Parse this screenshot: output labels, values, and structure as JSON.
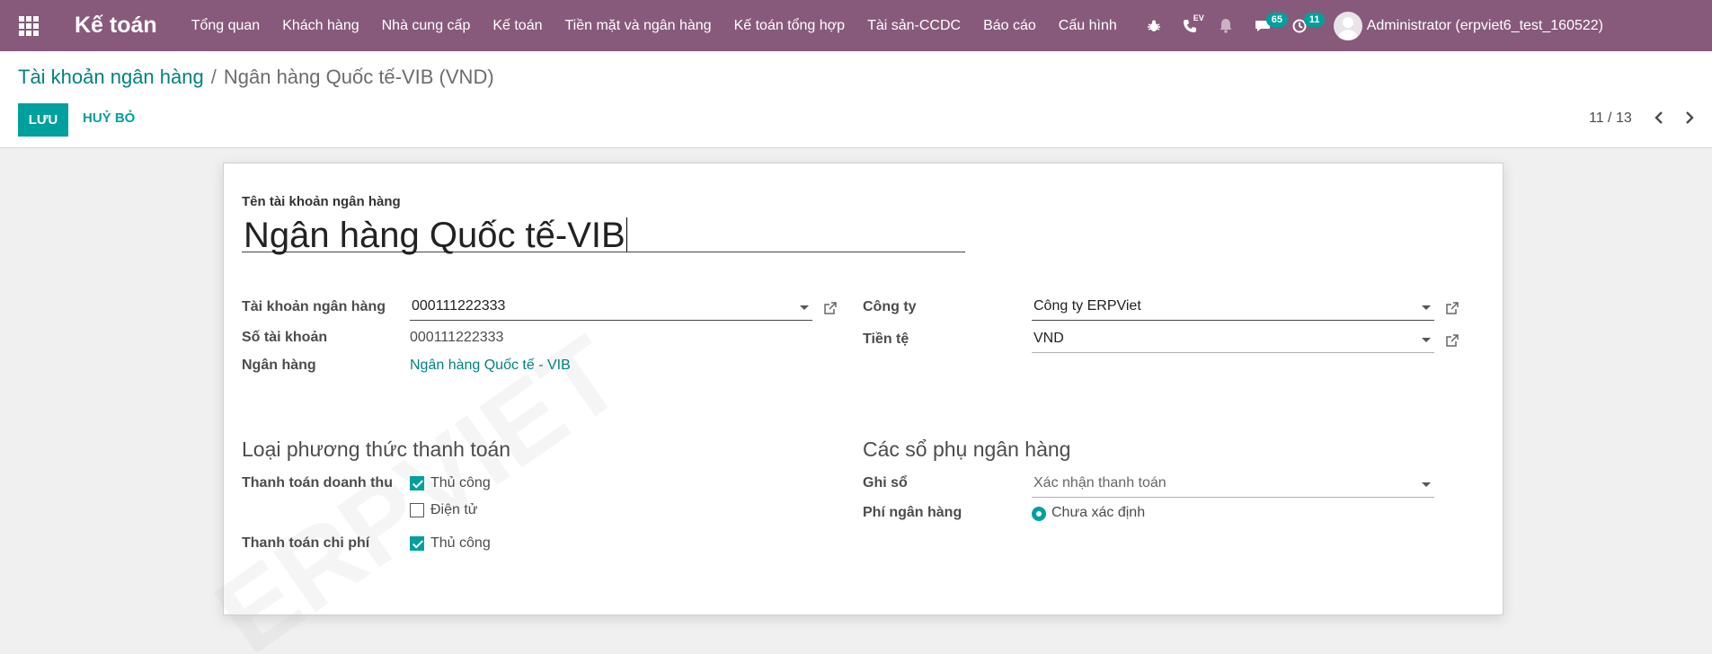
{
  "navbar": {
    "brand": "Kế toán",
    "menu": [
      "Tổng quan",
      "Khách hàng",
      "Nhà cung cấp",
      "Kế toán",
      "Tiền mặt và ngân hàng",
      "Kế toán tổng hợp",
      "Tài sản-CCDC",
      "Báo cáo",
      "Cấu hình"
    ],
    "systray": {
      "ev_label": "EV",
      "messages_count": "65",
      "activities_count": "11"
    },
    "user": "Administrator (erpviet6_test_160522)"
  },
  "breadcrumb": {
    "parent": "Tài khoản ngân hàng",
    "separator": "/",
    "current": "Ngân hàng Quốc tế-VIB (VND)"
  },
  "buttons": {
    "save": "LƯU",
    "discard": "HUỶ BỎ"
  },
  "pager": {
    "value": "11 / 13"
  },
  "form": {
    "name_label": "Tên tài khoản ngân hàng",
    "name_value": "Ngân hàng Quốc tế-VIB",
    "left": {
      "bank_account_label": "Tài khoản ngân hàng",
      "bank_account_value": "000111222333",
      "account_number_label": "Số tài khoản",
      "account_number_value": "000111222333",
      "bank_label": "Ngân hàng",
      "bank_value": "Ngân hàng Quốc tế - VIB"
    },
    "right": {
      "company_label": "Công ty",
      "company_value": "Công ty ERPViet",
      "currency_label": "Tiền tệ",
      "currency_value": "VND"
    },
    "payment_methods": {
      "title": "Loại phương thức thanh toán",
      "inbound_label": "Thanh toán doanh thu",
      "inbound_options": [
        {
          "label": "Thủ công",
          "checked": true
        },
        {
          "label": "Điện tử",
          "checked": false
        }
      ],
      "outbound_label": "Thanh toán chi phí",
      "outbound_options": [
        {
          "label": "Thủ công",
          "checked": true
        }
      ]
    },
    "bank_journals": {
      "title": "Các sổ phụ ngân hàng",
      "post_label": "Ghi sổ",
      "post_value": "Xác nhận thanh toán",
      "fee_label": "Phí ngân hàng",
      "fee_value": "Chưa xác định"
    }
  },
  "colors": {
    "navbar": "#875a7b",
    "primary": "#00a09d",
    "link": "#00827f"
  }
}
